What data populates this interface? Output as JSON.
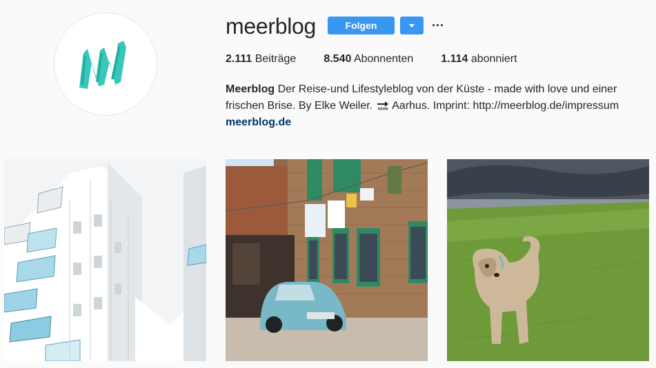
{
  "profile": {
    "username": "meerblog",
    "avatar_letter": "M",
    "avatar_color": "#2ec4b6"
  },
  "actions": {
    "follow_label": "Folgen",
    "accent": "#3897f0"
  },
  "stats": [
    {
      "value": "2.111",
      "label": "Beiträge"
    },
    {
      "value": "8.540",
      "label": "Abonnenten"
    },
    {
      "value": "1.114",
      "label": "abonniert"
    }
  ],
  "bio": {
    "name": "Meerblog",
    "line1_text": " Der Reise-und Lifestyleblog von der Küste - made with love und einer",
    "line2_before": "frischen Brise. By Elke Weiler. ",
    "soon_icon": "SOON",
    "line2_after": " Aarhus. Imprint: http://meerblog.de/impressum",
    "link": "meerblog.de"
  },
  "posts": [
    {
      "description_icon": "white-apartment-building-photo"
    },
    {
      "description_icon": "blue-beetle-car-photo"
    },
    {
      "description_icon": "dog-on-grass-photo"
    }
  ]
}
